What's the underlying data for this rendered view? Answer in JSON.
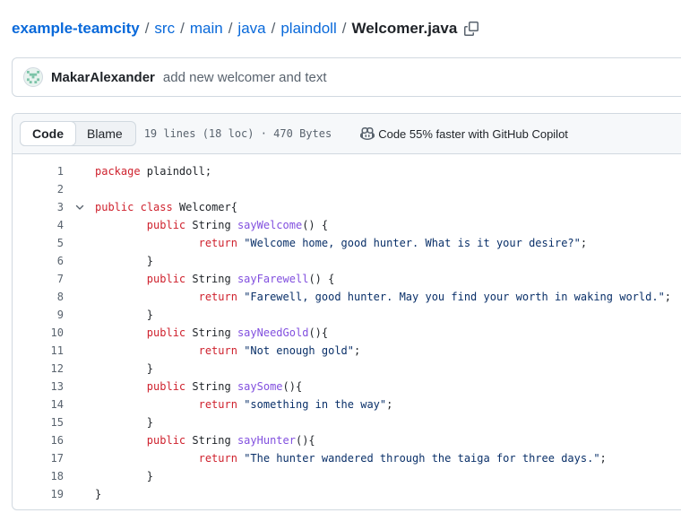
{
  "breadcrumb": {
    "repo": "example-teamcity",
    "parts": [
      "src",
      "main",
      "java",
      "plaindoll"
    ],
    "separator": "/",
    "file": "Welcomer.java",
    "copy_icon": "copy-icon"
  },
  "commit": {
    "author": "MakarAlexander",
    "message": "add new welcomer and text",
    "avatar_icon": "identicon"
  },
  "file_header": {
    "tabs": [
      "Code",
      "Blame"
    ],
    "active_tab": "Code",
    "meta": "19 lines (18 loc) · 470 Bytes",
    "copilot_text": "Code 55% faster with GitHub Copilot",
    "copilot_icon": "copilot-icon"
  },
  "colors": {
    "link": "#0969da",
    "keyword": "#cf222e",
    "function": "#8250df",
    "string": "#0a3069",
    "muted": "#59636e"
  },
  "code": {
    "lines": [
      {
        "n": "1",
        "fold": false,
        "tokens": [
          [
            "kw",
            "package"
          ],
          [
            "t",
            " plaindoll;"
          ]
        ]
      },
      {
        "n": "2",
        "fold": false,
        "tokens": []
      },
      {
        "n": "3",
        "fold": true,
        "tokens": [
          [
            "kw",
            "public"
          ],
          [
            "t",
            " "
          ],
          [
            "kw",
            "class"
          ],
          [
            "t",
            " Welcomer{"
          ]
        ]
      },
      {
        "n": "4",
        "fold": false,
        "tokens": [
          [
            "t",
            "        "
          ],
          [
            "kw",
            "public"
          ],
          [
            "t",
            " String "
          ],
          [
            "fn",
            "sayWelcome"
          ],
          [
            "t",
            "() {"
          ]
        ]
      },
      {
        "n": "5",
        "fold": false,
        "tokens": [
          [
            "t",
            "                "
          ],
          [
            "kw",
            "return"
          ],
          [
            "t",
            " "
          ],
          [
            "str",
            "\"Welcome home, good hunter. What is it your desire?\""
          ],
          [
            "t",
            ";"
          ]
        ]
      },
      {
        "n": "6",
        "fold": false,
        "tokens": [
          [
            "t",
            "        }"
          ]
        ]
      },
      {
        "n": "7",
        "fold": false,
        "tokens": [
          [
            "t",
            "        "
          ],
          [
            "kw",
            "public"
          ],
          [
            "t",
            " String "
          ],
          [
            "fn",
            "sayFarewell"
          ],
          [
            "t",
            "() {"
          ]
        ]
      },
      {
        "n": "8",
        "fold": false,
        "tokens": [
          [
            "t",
            "                "
          ],
          [
            "kw",
            "return"
          ],
          [
            "t",
            " "
          ],
          [
            "str",
            "\"Farewell, good hunter. May you find your worth in waking world.\""
          ],
          [
            "t",
            ";"
          ]
        ]
      },
      {
        "n": "9",
        "fold": false,
        "tokens": [
          [
            "t",
            "        }"
          ]
        ]
      },
      {
        "n": "10",
        "fold": false,
        "tokens": [
          [
            "t",
            "        "
          ],
          [
            "kw",
            "public"
          ],
          [
            "t",
            " String "
          ],
          [
            "fn",
            "sayNeedGold"
          ],
          [
            "t",
            "(){"
          ]
        ]
      },
      {
        "n": "11",
        "fold": false,
        "tokens": [
          [
            "t",
            "                "
          ],
          [
            "kw",
            "return"
          ],
          [
            "t",
            " "
          ],
          [
            "str",
            "\"Not enough gold\""
          ],
          [
            "t",
            ";"
          ]
        ]
      },
      {
        "n": "12",
        "fold": false,
        "tokens": [
          [
            "t",
            "        }"
          ]
        ]
      },
      {
        "n": "13",
        "fold": false,
        "tokens": [
          [
            "t",
            "        "
          ],
          [
            "kw",
            "public"
          ],
          [
            "t",
            " String "
          ],
          [
            "fn",
            "saySome"
          ],
          [
            "t",
            "(){"
          ]
        ]
      },
      {
        "n": "14",
        "fold": false,
        "tokens": [
          [
            "t",
            "                "
          ],
          [
            "kw",
            "return"
          ],
          [
            "t",
            " "
          ],
          [
            "str",
            "\"something in the way\""
          ],
          [
            "t",
            ";"
          ]
        ]
      },
      {
        "n": "15",
        "fold": false,
        "tokens": [
          [
            "t",
            "        }"
          ]
        ]
      },
      {
        "n": "16",
        "fold": false,
        "tokens": [
          [
            "t",
            "        "
          ],
          [
            "kw",
            "public"
          ],
          [
            "t",
            " String "
          ],
          [
            "fn",
            "sayHunter"
          ],
          [
            "t",
            "(){"
          ]
        ]
      },
      {
        "n": "17",
        "fold": false,
        "tokens": [
          [
            "t",
            "                "
          ],
          [
            "kw",
            "return"
          ],
          [
            "t",
            " "
          ],
          [
            "str",
            "\"The hunter wandered through the taiga for three days.\""
          ],
          [
            "t",
            ";"
          ]
        ]
      },
      {
        "n": "18",
        "fold": false,
        "tokens": [
          [
            "t",
            "        }"
          ]
        ]
      },
      {
        "n": "19",
        "fold": false,
        "tokens": [
          [
            "t",
            "}"
          ]
        ]
      }
    ]
  }
}
